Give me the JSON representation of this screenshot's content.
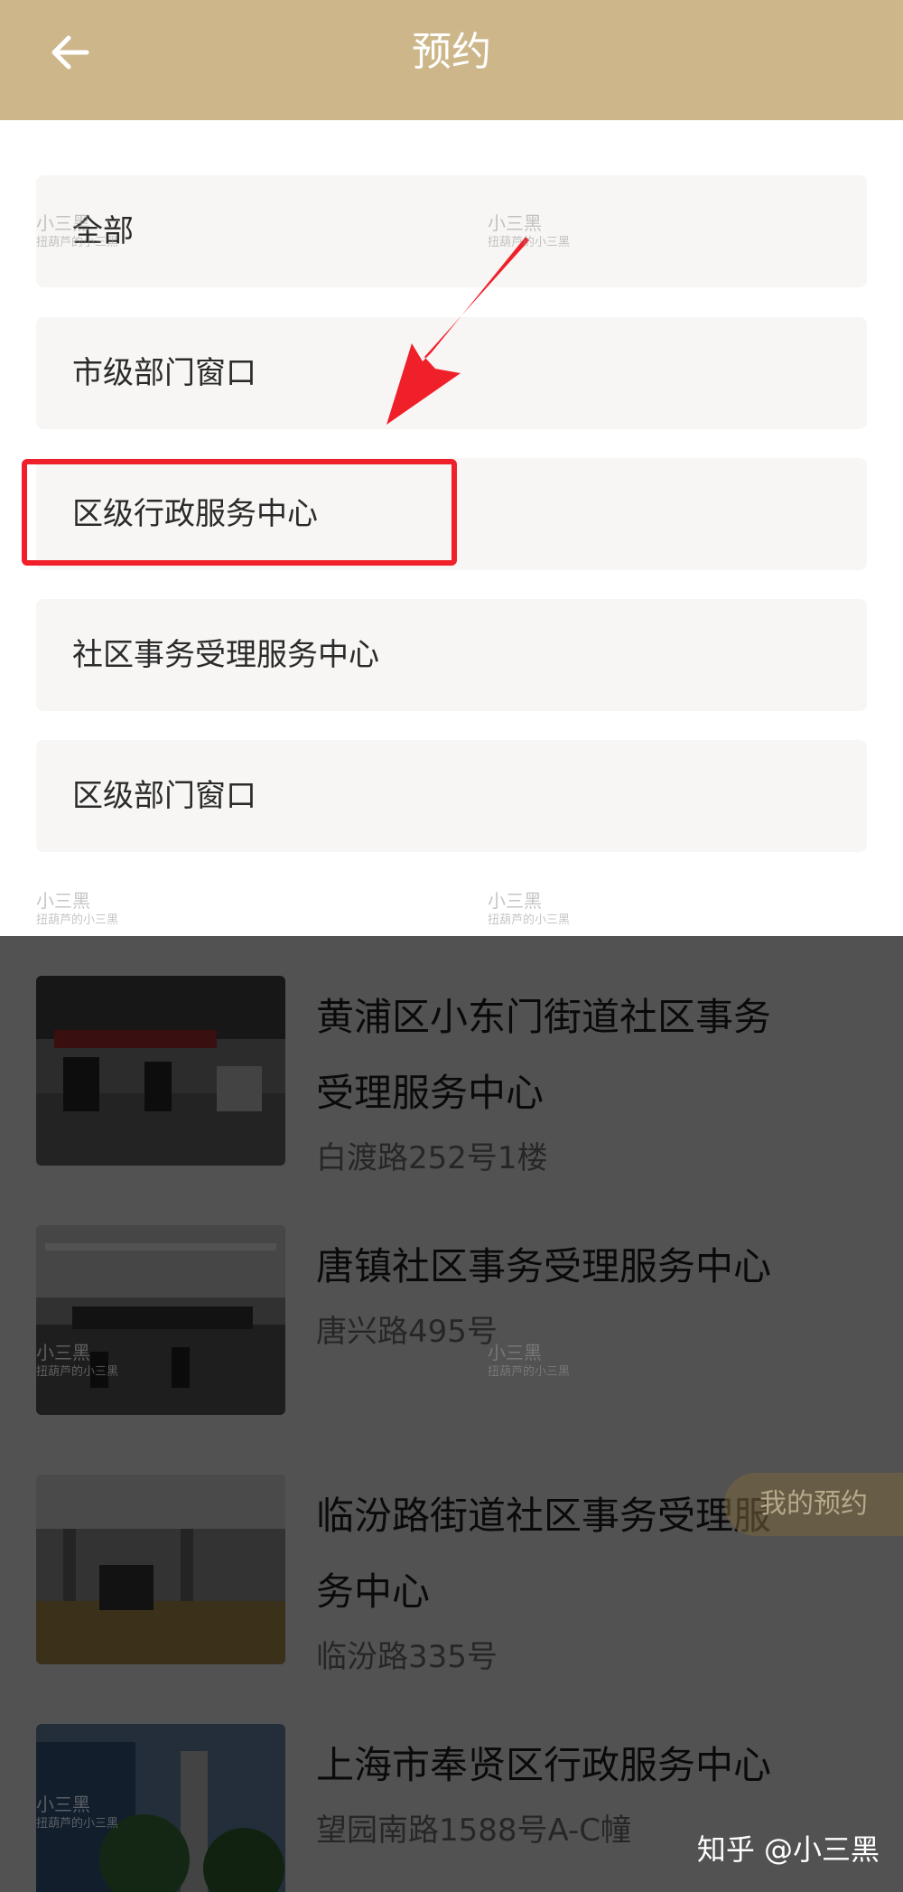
{
  "header": {
    "title": "预约",
    "back_icon": "arrow-left-icon"
  },
  "filters": [
    "全部",
    "市级部门窗口",
    "区级行政服务中心",
    "社区事务受理服务中心",
    "区级部门窗口"
  ],
  "highlighted_filter": "区级行政服务中心",
  "results": [
    {
      "name_line1": "黄浦区小东门街道社区事务",
      "name_line2": "受理服务中心",
      "address": "白渡路252号1楼"
    },
    {
      "name_line1": "唐镇社区事务受理服务中心",
      "name_line2": "",
      "address": "唐兴路495号"
    },
    {
      "name_line1": "临汾路街道社区事务受理服",
      "name_line2": "务中心",
      "address": "临汾路335号"
    },
    {
      "name_line1": "上海市奉贤区行政服务中心",
      "name_line2": "",
      "address": "望园南路1588号A-C幢"
    }
  ],
  "floating_button": "我的预约",
  "attribution": "知乎 @小三黑",
  "watermark": {
    "line1": "小三黑",
    "line2": "扭葫芦的小三黑"
  },
  "colors": {
    "header": "#cdb78a",
    "highlight": "#f0202a"
  }
}
